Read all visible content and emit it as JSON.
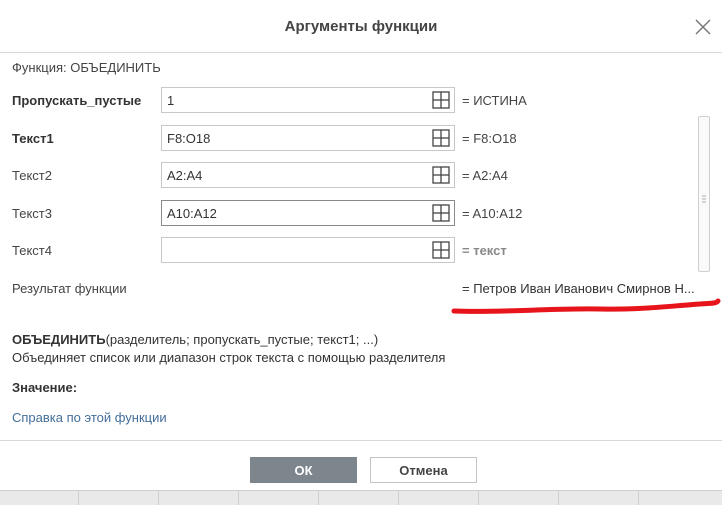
{
  "dialog": {
    "title": "Аргументы функции",
    "function_label": "Функция: ОБЪЕДИНИТЬ"
  },
  "args": [
    {
      "label": "Пропускать_пустые",
      "bold": true,
      "value": "1",
      "evaluated": "= ИСТИНА"
    },
    {
      "label": "Текст1",
      "bold": true,
      "value": "F8:O18",
      "evaluated": "= F8:O18"
    },
    {
      "label": "Текст2",
      "bold": false,
      "value": "A2:A4",
      "evaluated": "= A2:A4"
    },
    {
      "label": "Текст3",
      "bold": false,
      "value": "A10:A12",
      "evaluated": "= A10:A12"
    },
    {
      "label": "Текст4",
      "bold": false,
      "value": "",
      "evaluated": "= текст"
    }
  ],
  "result": {
    "label": "Результат функции",
    "value": "= Петров Иван Иванович Смирнов Н..."
  },
  "description": {
    "function_name": "ОБЪЕДИНИТЬ",
    "signature_args": "(разделитель; пропускать_пустые; текст1; ...)",
    "text": "Объединяет список или диапазон строк текста с помощью разделителя",
    "value_label": "Значение:",
    "help_link": "Справка по этой функции"
  },
  "buttons": {
    "ok": "ОК",
    "cancel": "Отмена"
  },
  "colors": {
    "ok_button": "#7d858d",
    "link": "#446e9b",
    "annotation_red": "#e8141b"
  }
}
